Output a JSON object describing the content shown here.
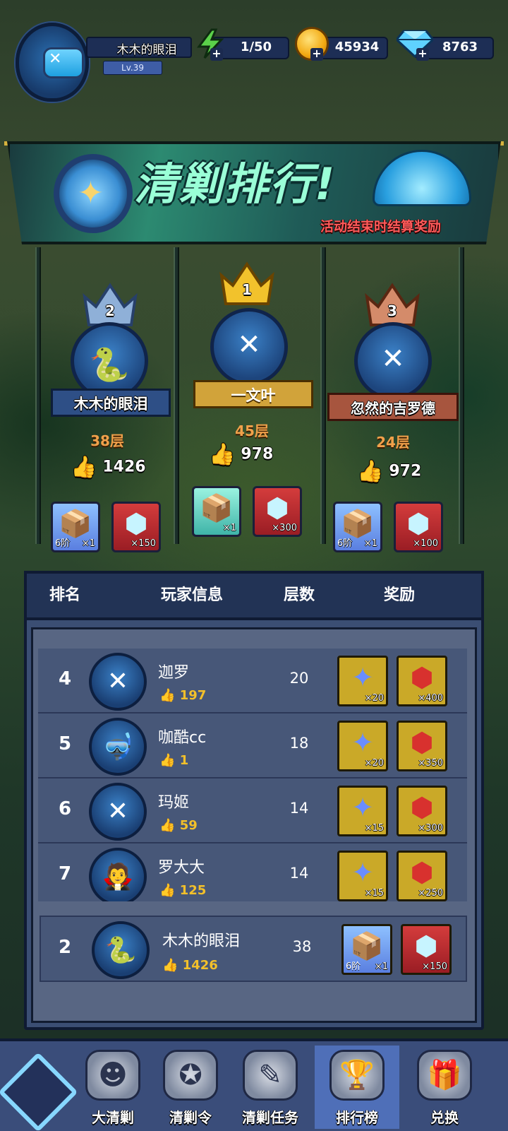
{
  "player": {
    "name": "木木的眼泪",
    "level": "Lv.39"
  },
  "resources": {
    "energy": "1/50",
    "gold": "45934",
    "diamond": "8763"
  },
  "banner": {
    "title": "清剿排行!",
    "subtitle": "活动结束时结算奖励"
  },
  "podium": [
    {
      "rank": "2",
      "name": "木木的眼泪",
      "floor": "38层",
      "likes": "1426",
      "reward1_tier": "6阶",
      "reward1_qty": "×1",
      "reward2_qty": "×150"
    },
    {
      "rank": "1",
      "name": "一文叶",
      "floor": "45层",
      "likes": "978",
      "reward1_tier": "",
      "reward1_qty": "×1",
      "reward2_qty": "×300"
    },
    {
      "rank": "3",
      "name": "忽然的吉罗德",
      "floor": "24层",
      "likes": "972",
      "reward1_tier": "6阶",
      "reward1_qty": "×1",
      "reward2_qty": "×100"
    }
  ],
  "table": {
    "headers": {
      "rank": "排名",
      "player": "玩家信息",
      "floor": "层数",
      "reward": "奖励"
    },
    "rows": [
      {
        "rank": "4",
        "name": "迦罗",
        "likes": "197",
        "floor": "20",
        "reward1_qty": "×20",
        "reward2_qty": "×400"
      },
      {
        "rank": "5",
        "name": "咖酷cc",
        "likes": "1",
        "floor": "18",
        "reward1_qty": "×20",
        "reward2_qty": "×350"
      },
      {
        "rank": "6",
        "name": "玛姬",
        "likes": "59",
        "floor": "14",
        "reward1_qty": "×15",
        "reward2_qty": "×300"
      },
      {
        "rank": "7",
        "name": "罗大大",
        "likes": "125",
        "floor": "14",
        "reward1_qty": "×15",
        "reward2_qty": "×250"
      }
    ],
    "mine": {
      "rank": "2",
      "name": "木木的眼泪",
      "likes": "1426",
      "floor": "38",
      "reward1_tier": "6阶",
      "reward1_qty": "×1",
      "reward2_qty": "×150"
    }
  },
  "nav": [
    {
      "label": "大清剿"
    },
    {
      "label": "清剿令"
    },
    {
      "label": "清剿任务"
    },
    {
      "label": "排行榜"
    },
    {
      "label": "兑换"
    }
  ]
}
